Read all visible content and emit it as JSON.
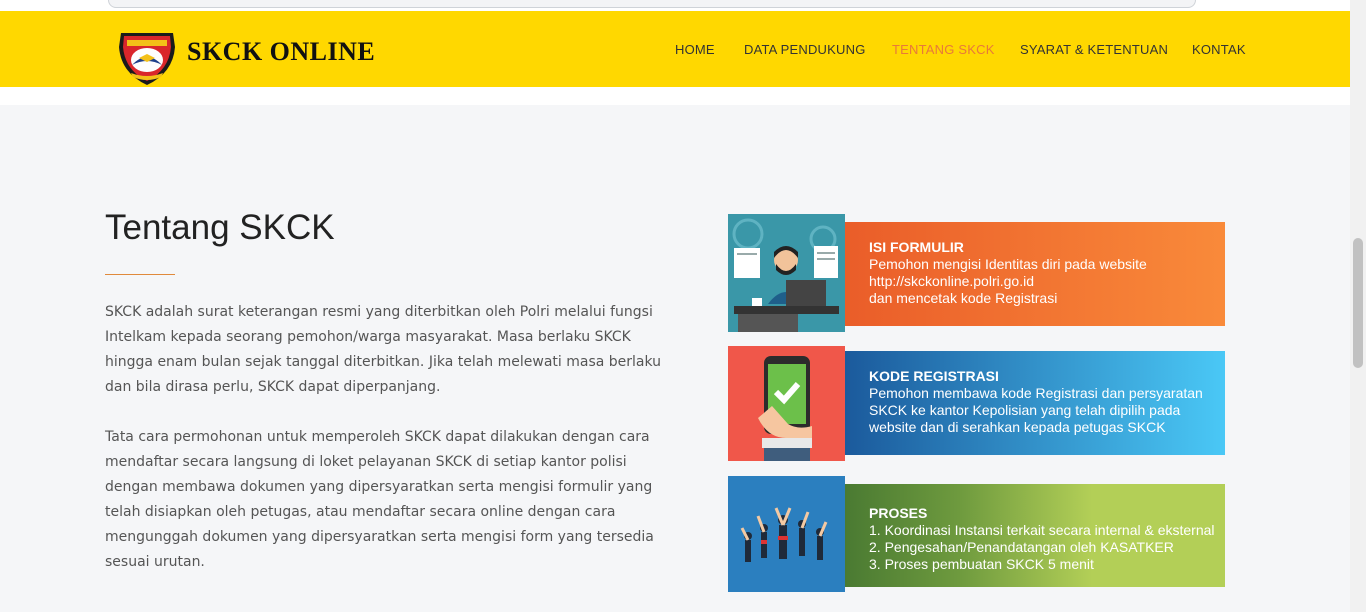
{
  "brand": {
    "name": "SKCK ONLINE"
  },
  "nav": {
    "items": [
      {
        "label": "HOME"
      },
      {
        "label": "DATA PENDUKUNG"
      },
      {
        "label": "TENTANG SKCK",
        "active": true
      },
      {
        "label": "SYARAT & KETENTUAN"
      },
      {
        "label": "KONTAK"
      }
    ]
  },
  "main": {
    "title": "Tentang SKCK",
    "paragraphs": [
      "SKCK adalah surat keterangan resmi yang diterbitkan oleh Polri melalui fungsi Intelkam kepada seorang pemohon/warga masyarakat. Masa berlaku SKCK hingga enam bulan sejak tanggal diterbitkan. Jika telah melewati masa berlaku dan bila dirasa perlu, SKCK dapat diperpanjang.",
      "Tata cara permohonan untuk memperoleh SKCK dapat dilakukan dengan cara mendaftar secara langsung di loket pelayanan SKCK di setiap kantor polisi dengan membawa dokumen yang dipersyaratkan serta mengisi formulir yang telah disiapkan oleh petugas, atau mendaftar secara online dengan cara mengunggah dokumen yang dipersyaratkan serta mengisi form yang tersedia sesuai urutan."
    ]
  },
  "steps": [
    {
      "title": "ISI FORMULIR",
      "description": "Pemohon mengisi Identitas diri pada website\nhttp://skckonline.polri.go.id\ndan mencetak kode Registrasi",
      "icon": "developer-illustration-icon",
      "color": "#f1702e"
    },
    {
      "title": "KODE REGISTRASI",
      "description": "Pemohon  membawa kode Registrasi dan persyaratan SKCK ke kantor Kepolisian yang telah dipilih pada website dan di serahkan kepada petugas SKCK",
      "icon": "phone-check-illustration-icon",
      "color": "#2aaee5"
    },
    {
      "title": "PROSES",
      "description": "1. Koordinasi Instansi terkait secara internal & eksternal\n2. Pengesahan/Penandatangan oleh KASATKER\n3. Proses pembuatan SKCK 5 menit",
      "icon": "team-celebration-illustration-icon",
      "color": "#a8c74a"
    }
  ]
}
